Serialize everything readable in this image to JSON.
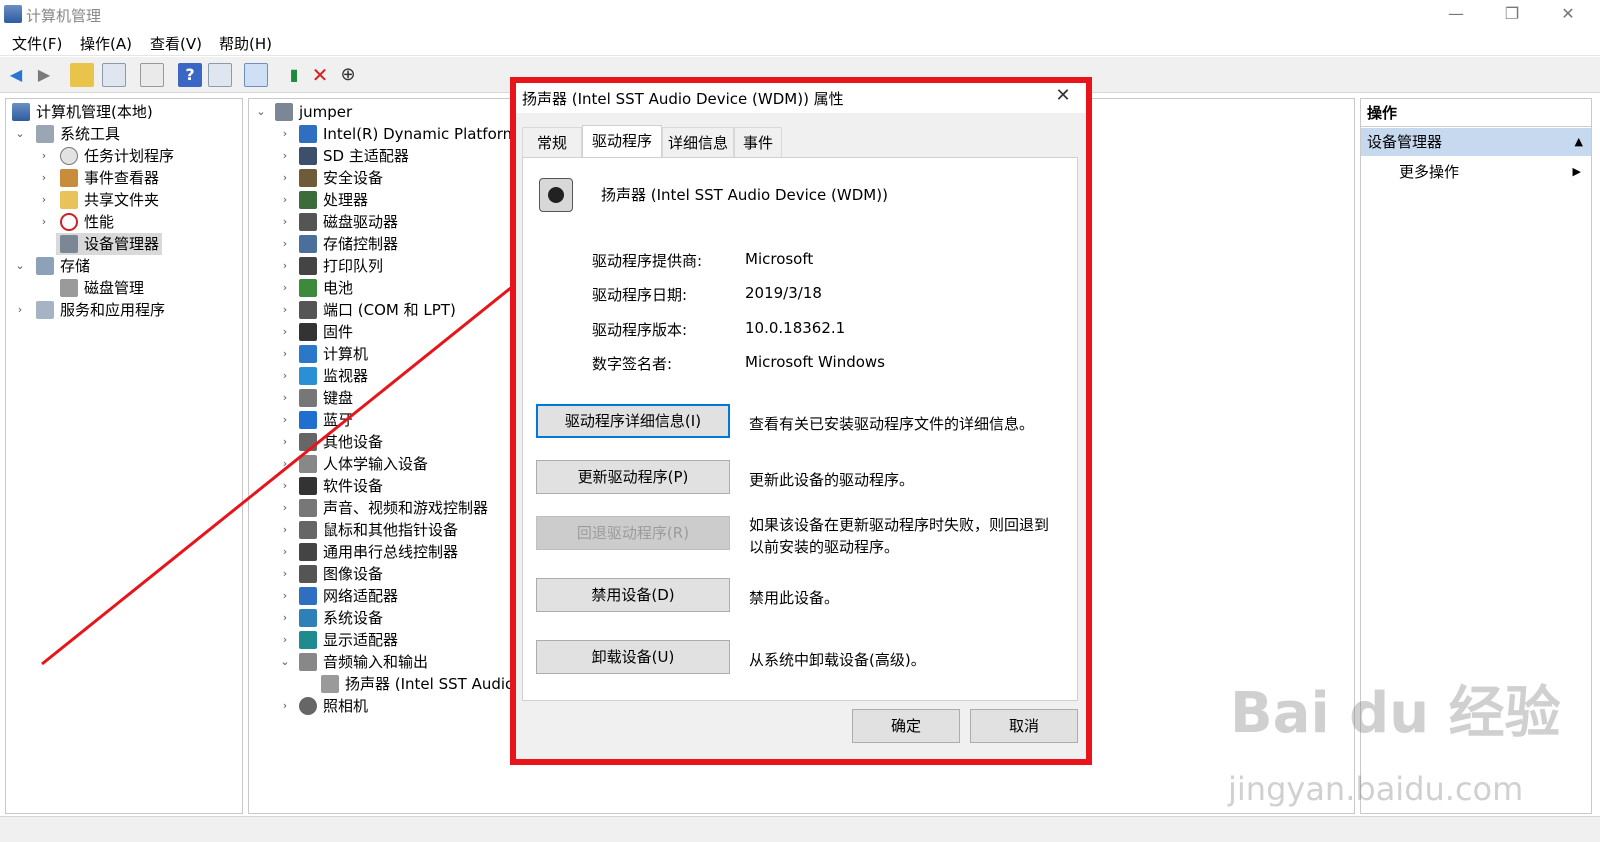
{
  "window": {
    "title": "计算机管理"
  },
  "menu": [
    "文件(F)",
    "操作(A)",
    "查看(V)",
    "帮助(H)"
  ],
  "left_tree": {
    "root": "计算机管理(本地)",
    "system_tools": "系统工具",
    "system_tools_items": [
      "任务计划程序",
      "事件查看器",
      "共享文件夹",
      "性能",
      "设备管理器"
    ],
    "storage": "存储",
    "storage_items": [
      "磁盘管理"
    ],
    "services": "服务和应用程序"
  },
  "device_tree": {
    "root": "jumper",
    "items": [
      "Intel(R) Dynamic Platform a",
      "SD 主适配器",
      "安全设备",
      "处理器",
      "磁盘驱动器",
      "存储控制器",
      "打印队列",
      "电池",
      "端口 (COM 和 LPT)",
      "固件",
      "计算机",
      "监视器",
      "键盘",
      "蓝牙",
      "其他设备",
      "人体学输入设备",
      "软件设备",
      "声音、视频和游戏控制器",
      "鼠标和其他指针设备",
      "通用串行总线控制器",
      "图像设备",
      "网络适配器",
      "系统设备",
      "显示适配器",
      "音频输入和输出"
    ],
    "child": "扬声器 (Intel SST Audio",
    "last": "照相机"
  },
  "actions": {
    "header": "操作",
    "section": "设备管理器",
    "more": "更多操作"
  },
  "dialog": {
    "title": "扬声器 (Intel SST Audio Device (WDM)) 属性",
    "tabs": [
      "常规",
      "驱动程序",
      "详细信息",
      "事件"
    ],
    "device_name": "扬声器 (Intel SST Audio Device (WDM))",
    "props": [
      {
        "label": "驱动程序提供商:",
        "value": "Microsoft"
      },
      {
        "label": "驱动程序日期:",
        "value": "2019/3/18"
      },
      {
        "label": "驱动程序版本:",
        "value": "10.0.18362.1"
      },
      {
        "label": "数字签名者:",
        "value": "Microsoft Windows"
      }
    ],
    "buttons": [
      {
        "label": "驱动程序详细信息(I)",
        "desc": "查看有关已安装驱动程序文件的详细信息。"
      },
      {
        "label": "更新驱动程序(P)",
        "desc": "更新此设备的驱动程序。"
      },
      {
        "label": "回退驱动程序(R)",
        "desc": "如果该设备在更新驱动程序时失败，则回退到以前安装的驱动程序。"
      },
      {
        "label": "禁用设备(D)",
        "desc": "禁用此设备。"
      },
      {
        "label": "卸载设备(U)",
        "desc": "从系统中卸载设备(高级)。"
      }
    ],
    "ok": "确定",
    "cancel": "取消"
  },
  "watermark": {
    "brand": "Bai du 经验",
    "url": "jingyan.baidu.com"
  },
  "colors": {
    "highlight": "#e8141a",
    "selection": "#d9d9d9",
    "action_section": "#c6d9ee"
  }
}
